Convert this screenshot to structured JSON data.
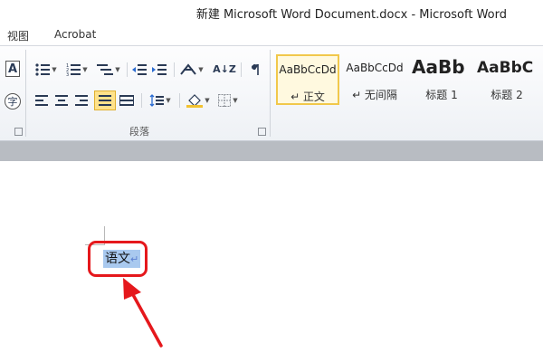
{
  "window": {
    "title": "新建 Microsoft Word Document.docx  -  Microsoft Word"
  },
  "menu": {
    "items": [
      "视图",
      "Acrobat"
    ]
  },
  "ribbon": {
    "paragraph_group_label": "段落",
    "left_icons": {
      "text_icon_glyph": "A",
      "phonetic_icon_glyph": "字"
    },
    "sort_glyph": "A↓Z"
  },
  "styles": {
    "tiles": [
      {
        "sample": "AaBbCcDd",
        "name": "↵ 正文",
        "selected": true
      },
      {
        "sample": "AaBbCcDd",
        "name": "↵ 无间隔",
        "selected": false
      },
      {
        "sample": "AaBb",
        "name": "标题 1",
        "selected": false
      },
      {
        "sample": "AaBbC",
        "name": "标题 2",
        "selected": false
      }
    ]
  },
  "document": {
    "selected_text": "语文",
    "paragraph_mark": "↵"
  },
  "colors": {
    "highlight_border": "#e5181c",
    "selection": "#a9c9ef",
    "active_button": "#ffe28a"
  }
}
